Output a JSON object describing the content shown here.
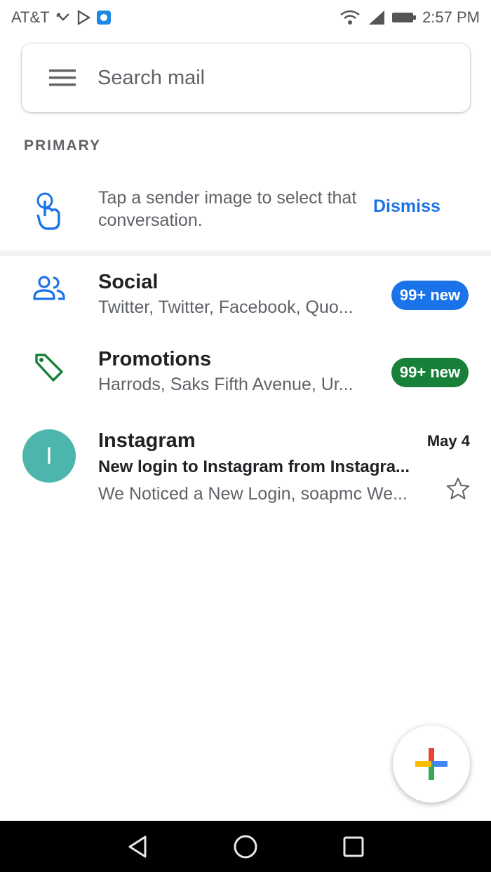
{
  "status_bar": {
    "carrier": "AT&T",
    "time": "2:57 PM"
  },
  "search": {
    "placeholder": "Search mail"
  },
  "section": {
    "label": "PRIMARY"
  },
  "tip": {
    "text": "Tap a sender image to select that conversation.",
    "dismiss_label": "Dismiss"
  },
  "categories": [
    {
      "title": "Social",
      "subtitle": "Twitter, Twitter, Facebook, Quo...",
      "badge": "99+ new",
      "badge_color": "#1a73e8",
      "icon": "people-icon",
      "icon_color": "#1a73e8"
    },
    {
      "title": "Promotions",
      "subtitle": "Harrods, Saks Fifth Avenue, Ur...",
      "badge": "99+ new",
      "badge_color": "#188038",
      "icon": "tag-icon",
      "icon_color": "#188038"
    }
  ],
  "emails": [
    {
      "avatar_letter": "I",
      "avatar_color": "#4db6ac",
      "sender": "Instagram",
      "date": "May 4",
      "subject": "New login to Instagram from Instagra...",
      "snippet": "We Noticed a New Login, soapmc We..."
    }
  ]
}
